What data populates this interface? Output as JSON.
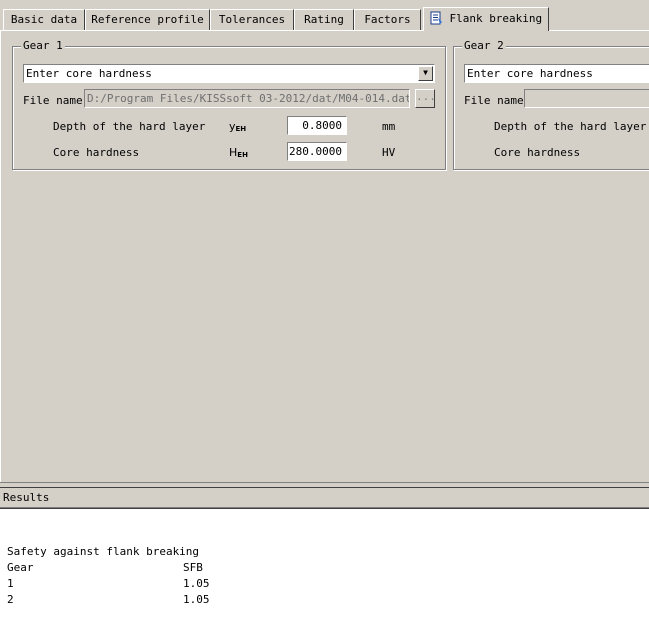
{
  "tabs": [
    {
      "label": "Basic data"
    },
    {
      "label": "Reference profile"
    },
    {
      "label": "Tolerances"
    },
    {
      "label": "Rating"
    },
    {
      "label": "Factors"
    },
    {
      "label": "Flank breaking",
      "icon": "document-icon",
      "active": true
    }
  ],
  "gear1": {
    "title": "Gear 1",
    "mode": "Enter core hardness",
    "file_label": "File name",
    "file_path": "D:/Program Files/KISSsoft 03-2012/dat/M04-014.dat",
    "browse_label": "...",
    "depth_label": "Depth of the hard layer",
    "depth_symbol": "y",
    "depth_sub": "EH",
    "depth_value": "0.8000",
    "depth_unit": "mm",
    "core_label": "Core hardness",
    "core_symbol": "H",
    "core_sub": "EH",
    "core_value": "280.0000",
    "core_unit": "HV"
  },
  "gear2": {
    "title": "Gear 2",
    "mode": "Enter core hardness",
    "file_label": "File name",
    "file_path": "",
    "depth_label": "Depth of the hard layer",
    "core_label": "Core hardness"
  },
  "results": {
    "header": "Results",
    "title": "Safety against flank breaking",
    "col1": "Gear",
    "col2": "SFB",
    "rows": [
      {
        "gear": "1",
        "sfb": "1.05"
      },
      {
        "gear": "2",
        "sfb": "1.05"
      }
    ]
  }
}
